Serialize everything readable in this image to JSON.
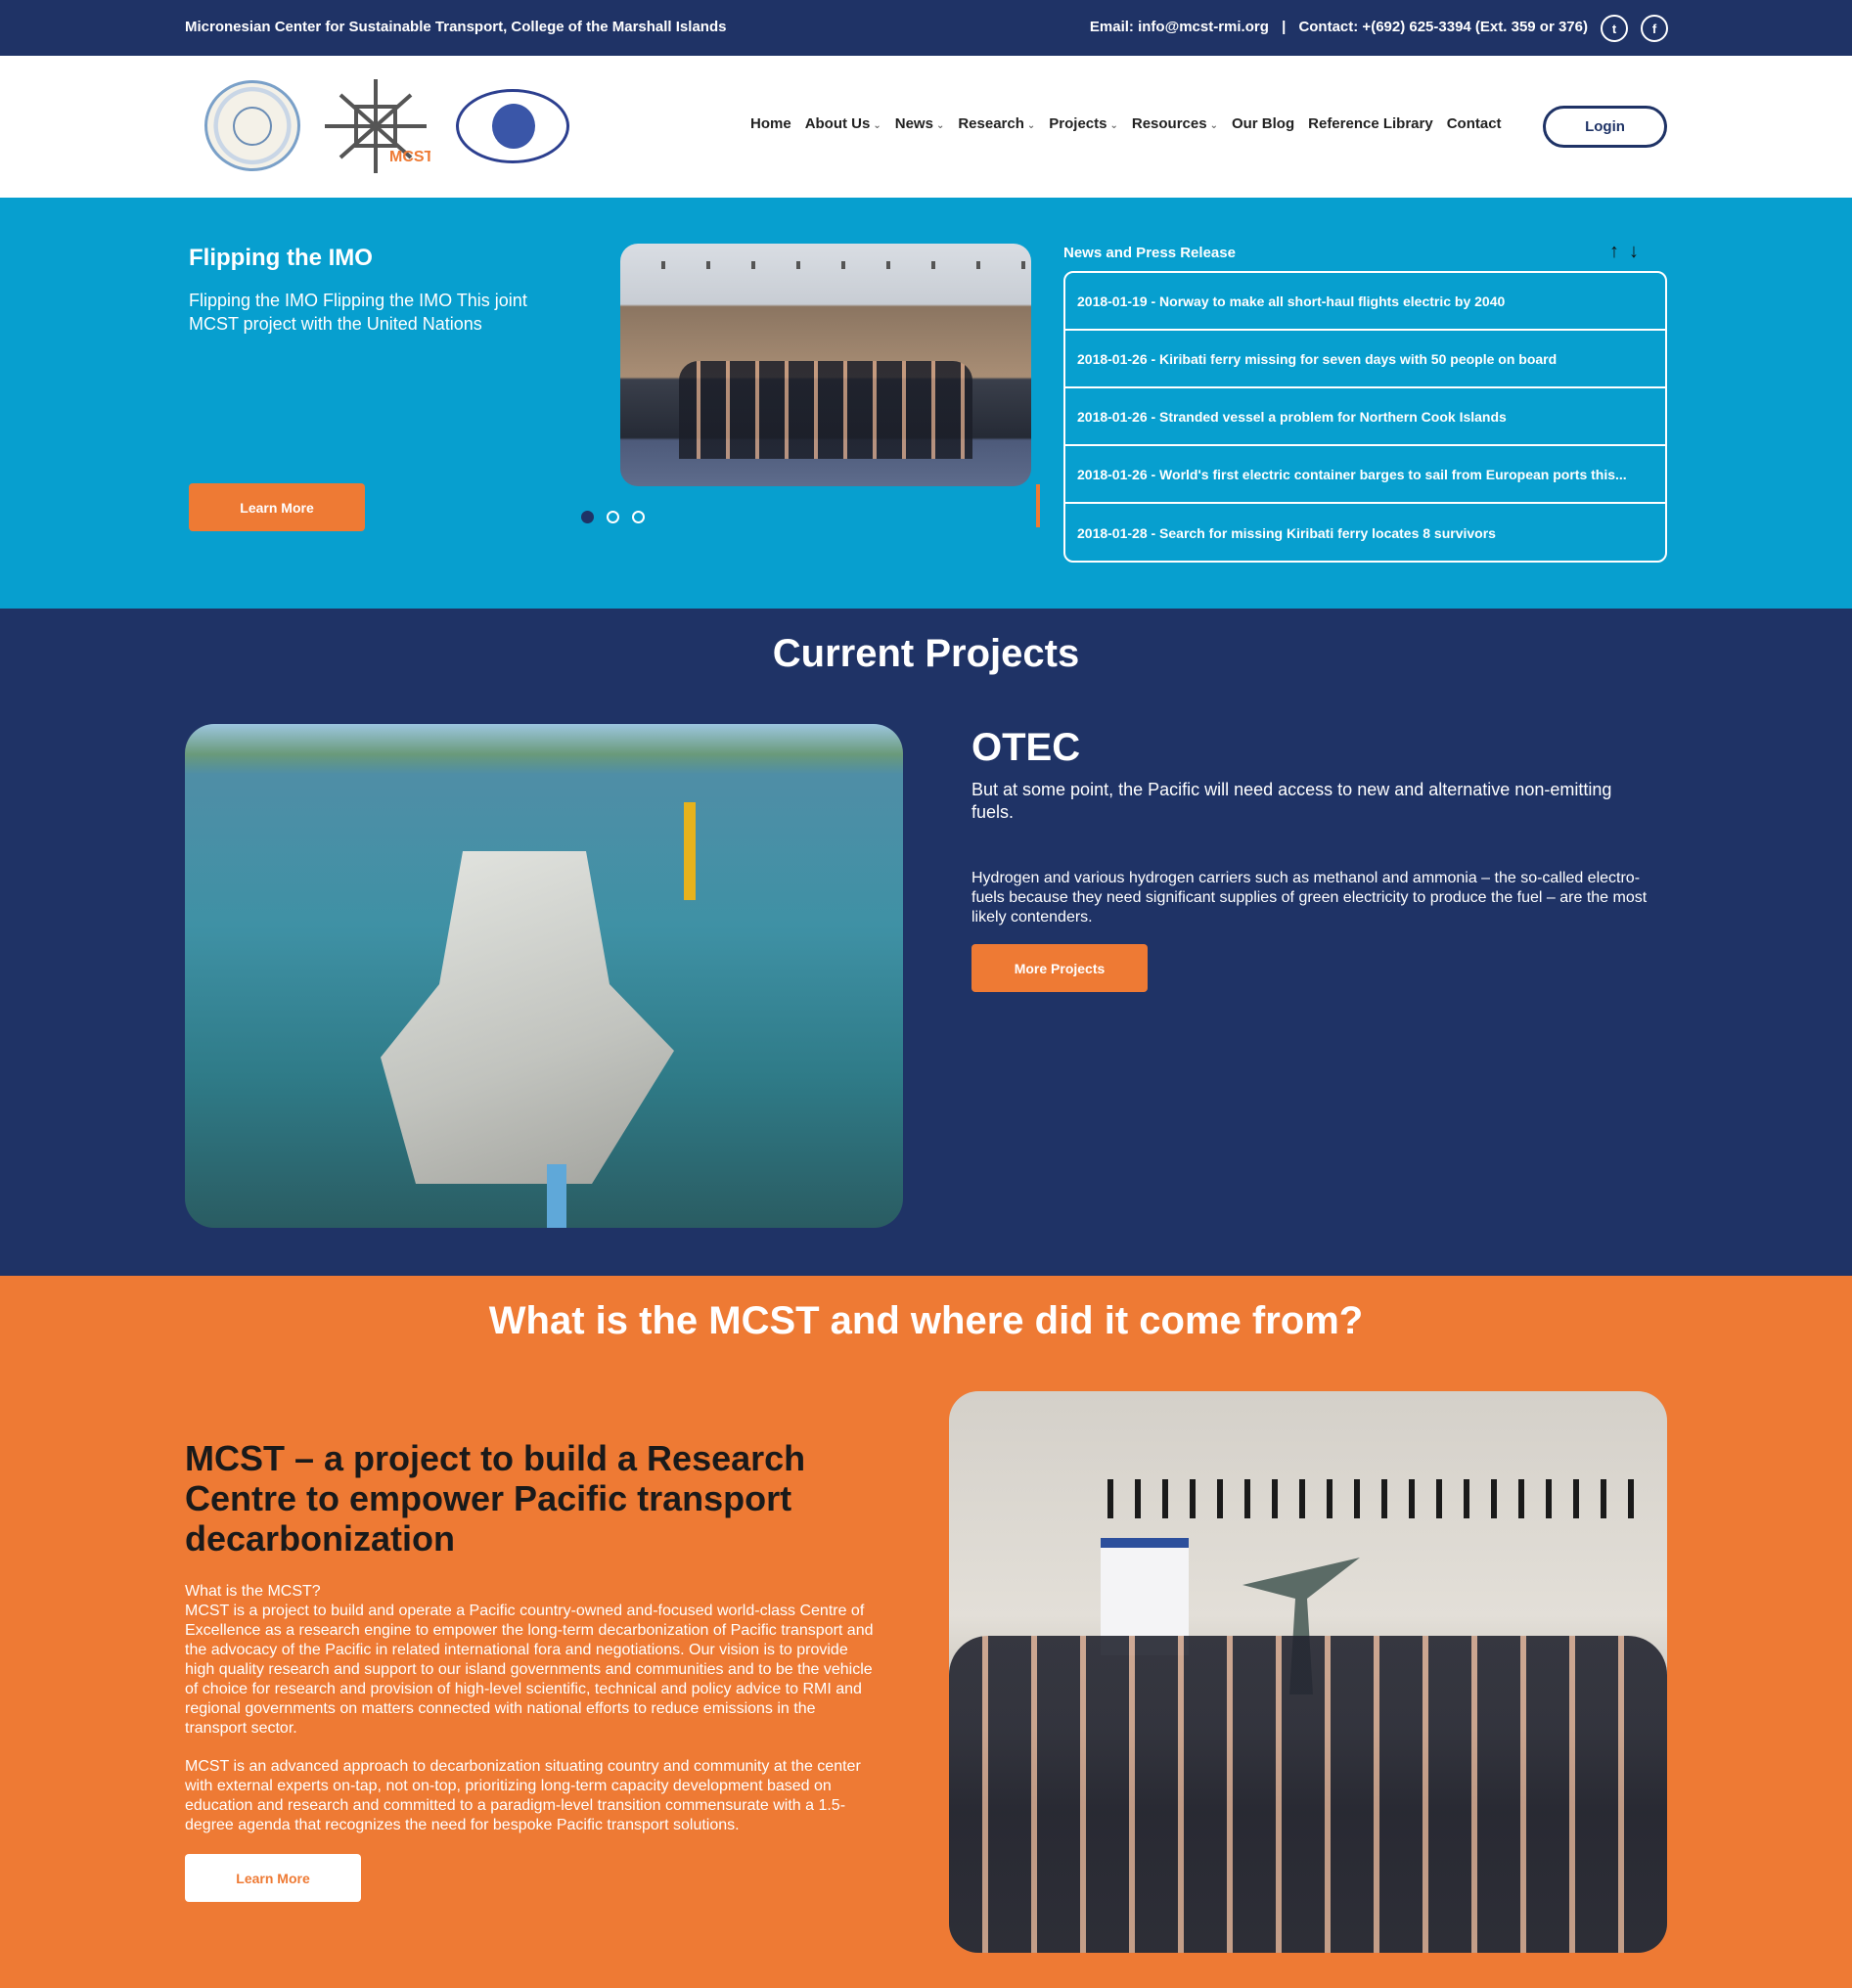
{
  "topbar": {
    "org": "Micronesian Center for Sustainable Transport, College of the Marshall Islands",
    "email": "Email: info@mcst-rmi.org",
    "separator": "|",
    "phone": "Contact: +(692) 625-3394 (Ext. 359 or 376)",
    "social": [
      {
        "icon": "twitter-icon",
        "glyph": "t"
      },
      {
        "icon": "facebook-icon",
        "glyph": "f"
      }
    ]
  },
  "header": {
    "logos": [
      "marshall-islands-seal",
      "mcst-logo",
      "college-marshall-islands-seal"
    ],
    "mcst_logo_text": "MCST",
    "nav": [
      {
        "label": "Home",
        "dropdown": false
      },
      {
        "label": "About Us",
        "dropdown": true
      },
      {
        "label": "News",
        "dropdown": true
      },
      {
        "label": "Research",
        "dropdown": true
      },
      {
        "label": "Projects",
        "dropdown": true
      },
      {
        "label": "Resources",
        "dropdown": true
      },
      {
        "label": "Our Blog",
        "dropdown": false
      },
      {
        "label": "Reference Library",
        "dropdown": false
      },
      {
        "label": "Contact",
        "dropdown": false
      }
    ],
    "chevron": "⌄",
    "login": "Login"
  },
  "hero": {
    "title": "Flipping the IMO",
    "text": "Flipping the IMO Flipping the IMO This joint MCST project with the United Nations",
    "button": "Learn More",
    "slides_total": 3,
    "active_slide": 1,
    "news_heading": "News and Press Release",
    "arrows": "↑↓",
    "news": [
      "2018-01-19 - Norway to make all short-haul flights electric by 2040",
      "2018-01-26 - Kiribati ferry missing for seven days with 50 people on board",
      "2018-01-26 - Stranded vessel a problem for Northern Cook Islands",
      "2018-01-26 - World's first electric container barges to sail from European ports this...",
      "2018-01-28 - Search for missing Kiribati ferry locates 8 survivors"
    ]
  },
  "projects": {
    "heading": "Current Projects",
    "title": "OTEC",
    "p1": "But at some point, the Pacific will need access to new and alternative non-emitting fuels.",
    "p2": "Hydrogen and various hydrogen carriers such as methanol and ammonia – the so-called electro-fuels because they need significant supplies of green electricity to produce the fuel – are the most likely contenders.",
    "button": "More Projects"
  },
  "about": {
    "heading": "What is the MCST and where did it come from?",
    "title": "MCST – a project to build a Research Centre to empower Pacific transport decarbonization",
    "q": "What is the MCST?",
    "p1": "MCST is a project to build and operate a Pacific country-owned and-focused world-class Centre of Excellence as a research engine to empower the long-term decarbonization of Pacific transport and the advocacy of the Pacific in related international fora and negotiations. Our vision is to provide high quality research and support to our island governments and communities and to be the vehicle of choice for research and provision of high-level scientific, technical and policy advice to RMI and regional governments on matters connected with national efforts to reduce emissions in the transport sector.",
    "p2": "MCST is an advanced approach to decarbonization situating country and community at the center with external experts on-tap, not on-top, prioritizing long-term capacity development based on education and research and committed to a paradigm-level transition commensurate with a 1.5-degree agenda that recognizes the need for bespoke Pacific transport solutions.",
    "button": "Learn More"
  },
  "colors": {
    "navy": "#1f3366",
    "sky": "#079fcf",
    "orange": "#ee7a34"
  }
}
